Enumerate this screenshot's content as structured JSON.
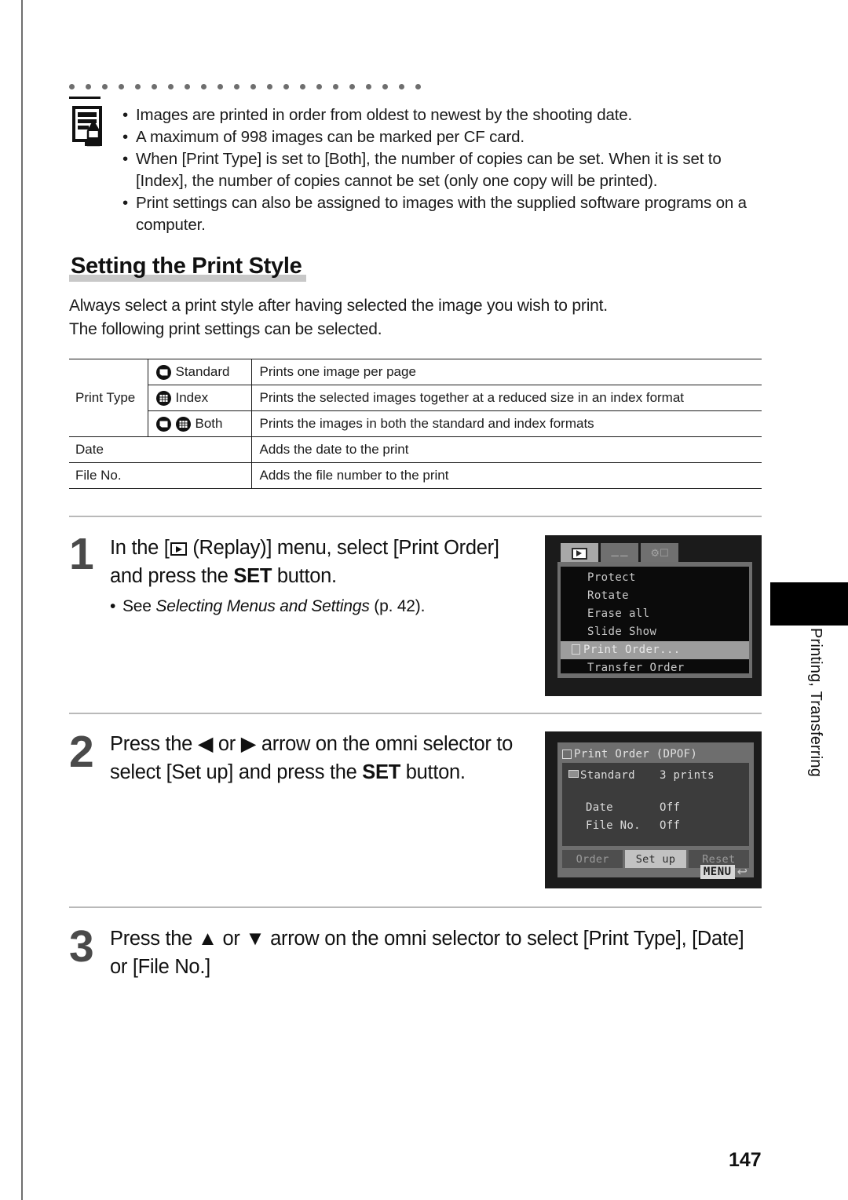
{
  "note": {
    "icon": "memo-pencil-icon",
    "items": [
      "Images are printed in order from oldest to newest by the shooting date.",
      "A maximum of 998 images can be marked per CF card.",
      "When [Print Type] is set to [Both], the number of copies can be set. When it is set to [Index], the number of copies cannot be set (only one copy will be printed).",
      "Print settings can also be assigned to images with the supplied software programs on a computer."
    ]
  },
  "section": {
    "heading": "Setting the Print Style",
    "intro_line1": "Always select a print style after having selected the image you wish to print.",
    "intro_line2": "The following print settings can be selected."
  },
  "settings_table": {
    "print_type_label": "Print Type",
    "rows": [
      {
        "option": "Standard",
        "icons": [
          "standard"
        ],
        "description": "Prints one image per page"
      },
      {
        "option": "Index",
        "icons": [
          "index"
        ],
        "description": "Prints the selected images together at a reduced size in an index format"
      },
      {
        "option": "Both",
        "icons": [
          "standard",
          "index"
        ],
        "description": "Prints the images in both the standard and index formats"
      }
    ],
    "date_label": "Date",
    "date_description": "Adds the date to the print",
    "fileno_label": "File No.",
    "fileno_description": "Adds the file number to the print"
  },
  "steps": {
    "step1": {
      "number": "1",
      "text_before_icon": "In the [",
      "text_after_icon": " (Replay)] menu, select [Print Order] and press the ",
      "set_label": "SET",
      "text_end": " button.",
      "substep_bullet": "•",
      "substep_see": "See ",
      "substep_italic": "Selecting Menus and Settings",
      "substep_page": " (p. 42)."
    },
    "step2": {
      "number": "2",
      "line1_a": "Press the ",
      "arrow_left": "◀",
      "line1_b": " or ",
      "arrow_right": "▶",
      "line1_c": " arrow on the omni selector to select [Set up] and press the ",
      "set_label": "SET",
      "line1_d": " button."
    },
    "step3": {
      "number": "3",
      "line_a": "Press the ",
      "arrow_up": "▲",
      "line_b": " or ",
      "arrow_down": "▼",
      "line_c": " arrow on the omni selector to select [Print Type], [Date] or [File No.]"
    }
  },
  "lcd_replay_menu": {
    "tabs": [
      {
        "name": "replay-tab",
        "icon": "replay-icon",
        "active": true
      },
      {
        "name": "tools-tab",
        "icon": "tools-icon",
        "active": false
      },
      {
        "name": "setup-tab",
        "icon": "setup-icon",
        "active": false
      }
    ],
    "items": [
      {
        "label": "Protect",
        "selected": false
      },
      {
        "label": "Rotate",
        "selected": false
      },
      {
        "label": "Erase all",
        "selected": false
      },
      {
        "label": "Slide Show",
        "selected": false
      },
      {
        "label": "Print Order...",
        "selected": true
      },
      {
        "label": "Transfer Order",
        "selected": false
      }
    ]
  },
  "lcd_print_order": {
    "title": "Print Order (DPOF)",
    "rows": [
      {
        "key": "Standard",
        "value": "3 prints",
        "has_square_icon": true,
        "indent": false
      },
      {
        "key": "Date",
        "value": "Off",
        "has_square_icon": false,
        "indent": true
      },
      {
        "key": "File No.",
        "value": "Off",
        "has_square_icon": false,
        "indent": true
      }
    ],
    "buttons": [
      {
        "label": "Order",
        "active": false
      },
      {
        "label": "Set up",
        "active": true
      },
      {
        "label": "Reset",
        "active": false
      }
    ],
    "menu_chip": "MENU",
    "menu_return_icon": "↩"
  },
  "side_tab": {
    "label": "Printing, Transferring"
  },
  "footer": {
    "page_number": "147"
  },
  "colors": {
    "heading_highlight": "#c8c8c8",
    "step_number": "#4a4a4a",
    "rule": "#b9b9b9",
    "lcd_frame": "#1b1b1b",
    "lcd_panel": "#6e6e6e",
    "lcd_selected": "#9d9d9d"
  }
}
